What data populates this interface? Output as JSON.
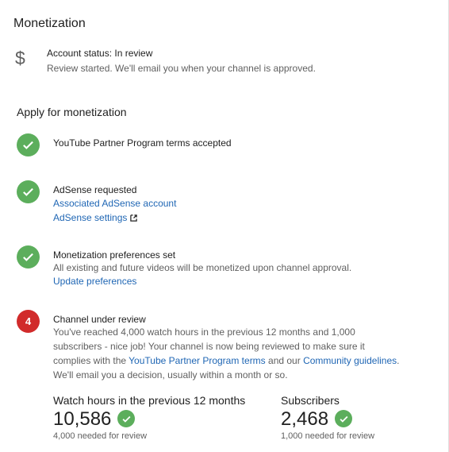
{
  "header": {
    "title": "Monetization"
  },
  "account_status": {
    "icon": "dollar-icon",
    "title": "Account status: In review",
    "description": "Review started. We'll email you when your channel is approved."
  },
  "apply": {
    "title": "Apply for monetization",
    "steps": [
      {
        "icon": "check-icon",
        "title": "YouTube Partner Program terms accepted"
      },
      {
        "icon": "check-icon",
        "title": "AdSense requested",
        "links": [
          "Associated AdSense account",
          "AdSense settings"
        ]
      },
      {
        "icon": "check-icon",
        "title": "Monetization preferences set",
        "description": "All existing and future videos will be monetized upon channel approval.",
        "links": [
          "Update preferences"
        ]
      },
      {
        "icon_number": "4",
        "title": "Channel under review",
        "description_parts": [
          "You've reached 4,000 watch hours in the previous 12 months and 1,000 subscribers - nice job! Your channel is now being reviewed to make sure it complies with the ",
          "YouTube Partner Program terms",
          " and our ",
          "Community guidelines",
          ". We'll email you a decision, usually within a month or so."
        ]
      }
    ]
  },
  "stats": {
    "watch_hours": {
      "label": "Watch hours in the previous 12 months",
      "value": "10,586",
      "requirement": "4,000 needed for review"
    },
    "subscribers": {
      "label": "Subscribers",
      "value": "2,468",
      "requirement": "1,000 needed for review"
    }
  },
  "colors": {
    "success": "#5cae5c",
    "alert": "#d12b2b",
    "link": "#1f66b4"
  }
}
